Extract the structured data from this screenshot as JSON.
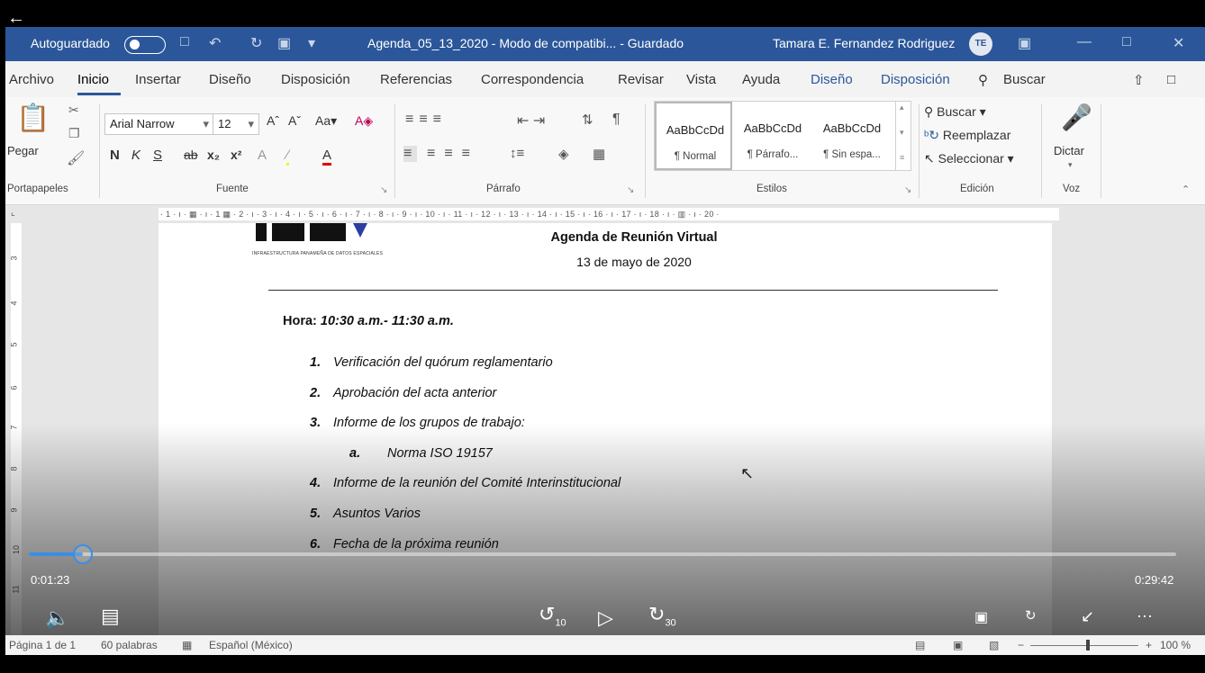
{
  "window": {
    "autosave_label": "Autoguardado",
    "doc_title": "Agenda_05_13_2020  -  Modo de compatibi...  - Guardado",
    "user_name": "Tamara E. Fernandez Rodriguez",
    "avatar_initials": "TE"
  },
  "tabs": [
    "Archivo",
    "Inicio",
    "Insertar",
    "Diseño",
    "Disposición",
    "Referencias",
    "Correspondencia",
    "Revisar",
    "Vista",
    "Ayuda",
    "Diseño",
    "Disposición"
  ],
  "search_label": "Buscar",
  "ribbon": {
    "paste_label": "Pegar",
    "font_name": "Arial Narrow",
    "font_size": "12",
    "styles": [
      {
        "sample": "AaBbCcDd",
        "name": "¶ Normal"
      },
      {
        "sample": "AaBbCcDd",
        "name": "¶ Párrafo..."
      },
      {
        "sample": "AaBbCcDd",
        "name": "¶ Sin espa..."
      }
    ],
    "edit_find": "Buscar",
    "edit_replace": "Reemplazar",
    "edit_select": "Seleccionar",
    "dictate": "Dictar",
    "groups": {
      "clipboard": "Portapapeles",
      "font": "Fuente",
      "paragraph": "Párrafo",
      "styles": "Estilos",
      "editing": "Edición",
      "voice": "Voz"
    }
  },
  "ruler_marks": "· 1 · ı · ▦ · ı · 1 ▦ · 2 · ı · 3 · ı · 4 · ı · 5 · ı · 6 · ı · 7 · ı · 8 · ı · 9 · ı · 10 · ı · 11 · ı · 12 · ı · 13 · ı · 14 · ı · 15 · ı · 16 · ı · 17 · ı · 18 · ı · ▥ · ı · 20 ·",
  "document": {
    "logo_caption": "INFRAESTRUCTURA PANAMEÑA DE DATOS ESPACIALES",
    "title": "Agenda de Reunión Virtual",
    "date": "13 de mayo de 2020",
    "hora_label": "Hora:",
    "hora_value": "10:30 a.m.- 11:30 a.m.",
    "items": [
      {
        "num": "1.",
        "text": "Verificación del quórum reglamentario"
      },
      {
        "num": "2.",
        "text": "Aprobación del acta anterior"
      },
      {
        "num": "3.",
        "text": "Informe de los grupos de trabajo:"
      },
      {
        "num": "a.",
        "text": "Norma ISO 19157"
      },
      {
        "num": "4.",
        "text": "Informe de la reunión del Comité Interinstitucional"
      },
      {
        "num": "5.",
        "text": "Asuntos Varios"
      },
      {
        "num": "6.",
        "text": "Fecha de la próxima reunión"
      }
    ]
  },
  "player": {
    "current_time": "0:01:23",
    "total_time": "0:29:42",
    "progress_fraction": 0.047,
    "skip_back": "10",
    "skip_forward": "30",
    "accent": "#3a8ee6"
  },
  "status": {
    "page": "Página 1 de 1",
    "words": "60 palabras",
    "language": "Español (México)",
    "zoom": "100 %"
  }
}
